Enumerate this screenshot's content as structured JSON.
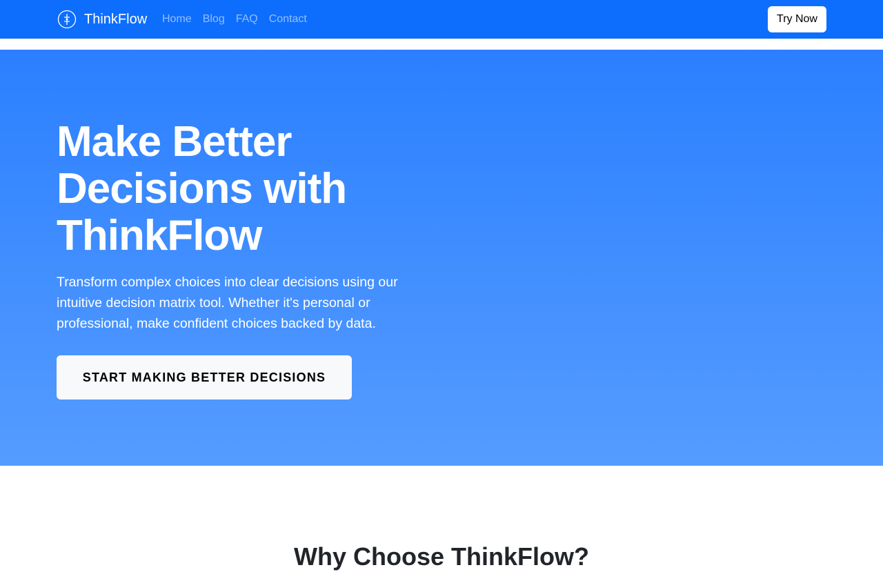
{
  "navbar": {
    "brand_name": "ThinkFlow",
    "logo_icon": "compass-icon",
    "links": [
      "Home",
      "Blog",
      "FAQ",
      "Contact"
    ],
    "cta_label": "Try Now"
  },
  "hero": {
    "title": "Make Better Decisions with ThinkFlow",
    "description": "Transform complex choices into clear decisions using our intuitive decision matrix tool. Whether it's personal or professional, make confident choices backed by data.",
    "cta_label": "START MAKING BETTER DECISIONS"
  },
  "features": {
    "title": "Why Choose ThinkFlow?"
  },
  "colors": {
    "navbar_bg": "#0d6efd",
    "hero_gradient_top": "#2b7fff",
    "hero_gradient_bottom": "#559cff",
    "button_bg": "#f8f9fa"
  }
}
